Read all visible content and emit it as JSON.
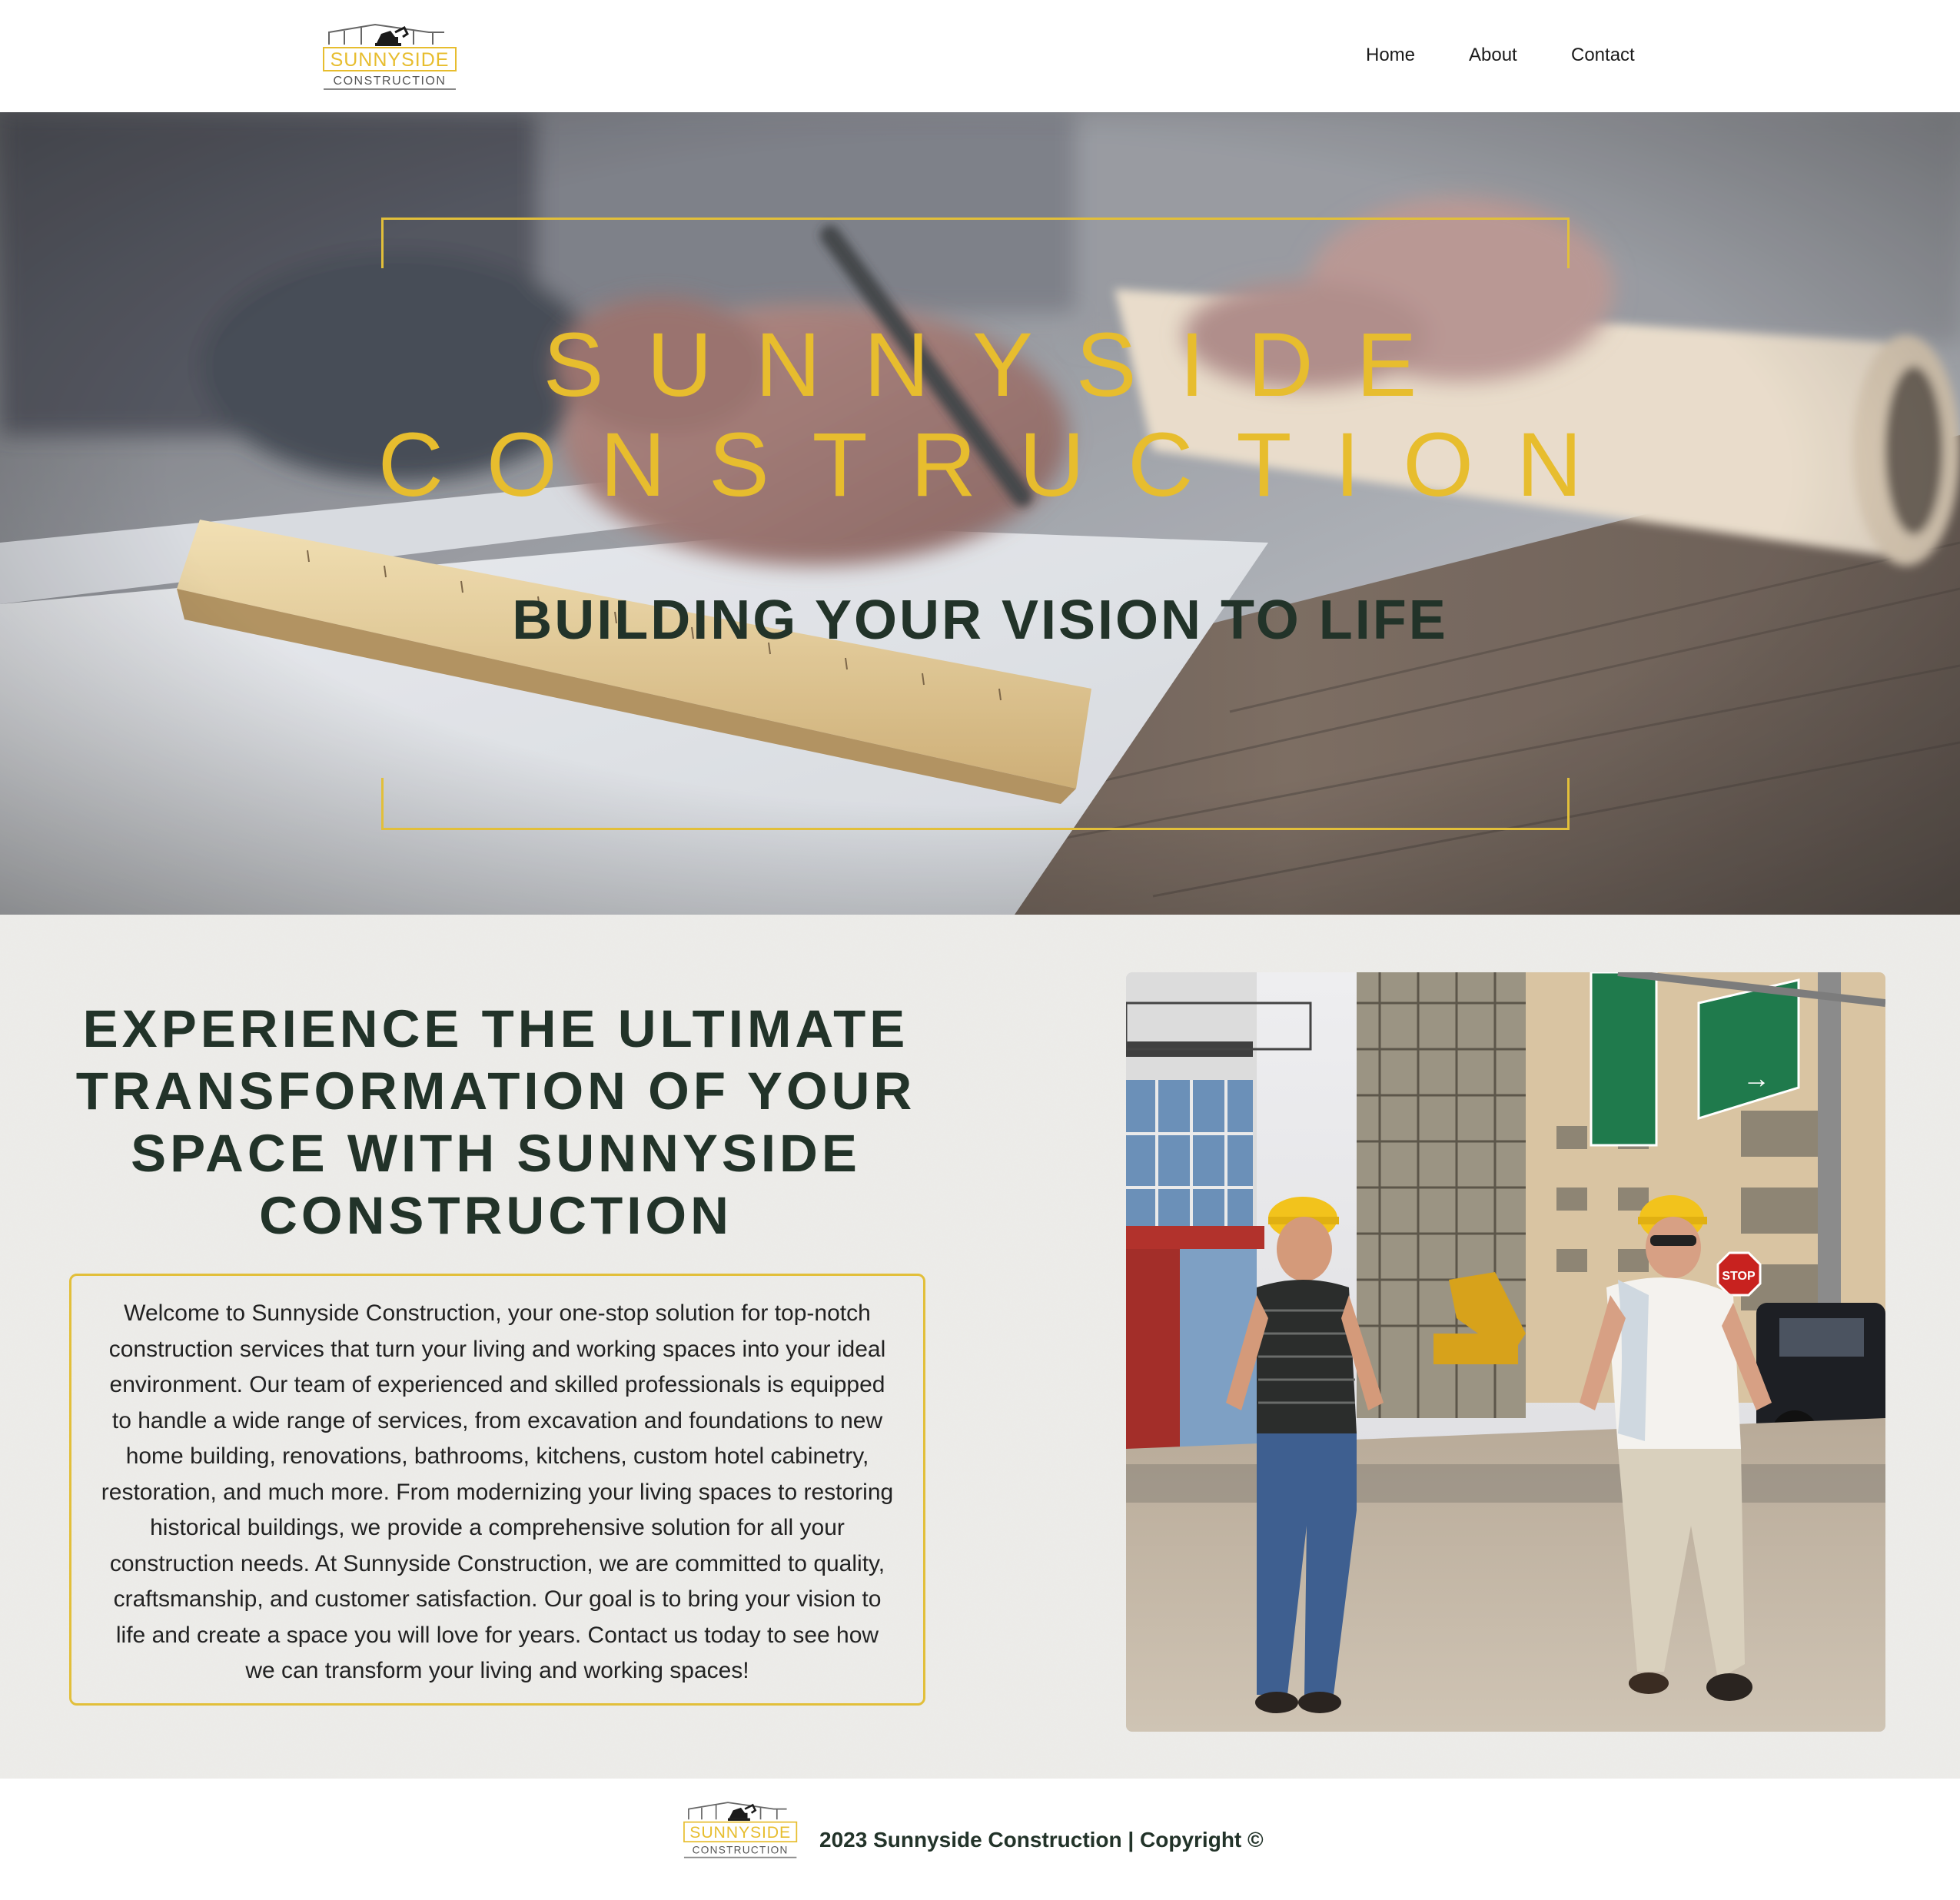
{
  "brand": {
    "logo_text_top": "SUNNYSIDE",
    "logo_text_bottom": "CONSTRUCTION",
    "accent_color": "#e7bd2e",
    "dark_color": "#223329"
  },
  "nav": {
    "items": [
      {
        "label": "Home"
      },
      {
        "label": "About"
      },
      {
        "label": "Contact"
      }
    ]
  },
  "hero": {
    "title_line1": "SUNNYSIDE",
    "title_line2": "CONSTRUCTION",
    "tagline": "BUILDING YOUR VISION TO LIFE"
  },
  "main": {
    "headline_lines": [
      "EXPERIENCE THE ULTIMATE",
      "TRANSFORMATION OF YOUR",
      "SPACE WITH SUNNYSIDE",
      "CONSTRUCTION"
    ],
    "body_lines": [
      "Welcome to Sunnyside Construction, your one-stop solution for top-notch",
      "construction services that turn your living and working spaces into your ideal",
      "environment. Our team of experienced and skilled professionals is equipped",
      "to handle a wide range of services, from excavation and foundations to new",
      "home building, renovations, bathrooms, kitchens, custom hotel cabinetry,",
      "restoration, and much more. From modernizing your living spaces to restoring",
      "historical buildings, we provide a comprehensive solution for all your",
      "construction needs. At Sunnyside Construction, we are committed to quality,",
      "craftsmanship, and customer satisfaction. Our goal is to bring your vision to",
      "life and create a space you will love for years. Contact us today to see how",
      "we can transform your living and working spaces!"
    ],
    "photo_sign": "STOP"
  },
  "footer": {
    "copyright": "2023 Sunnyside Construction | Copyright ©"
  }
}
